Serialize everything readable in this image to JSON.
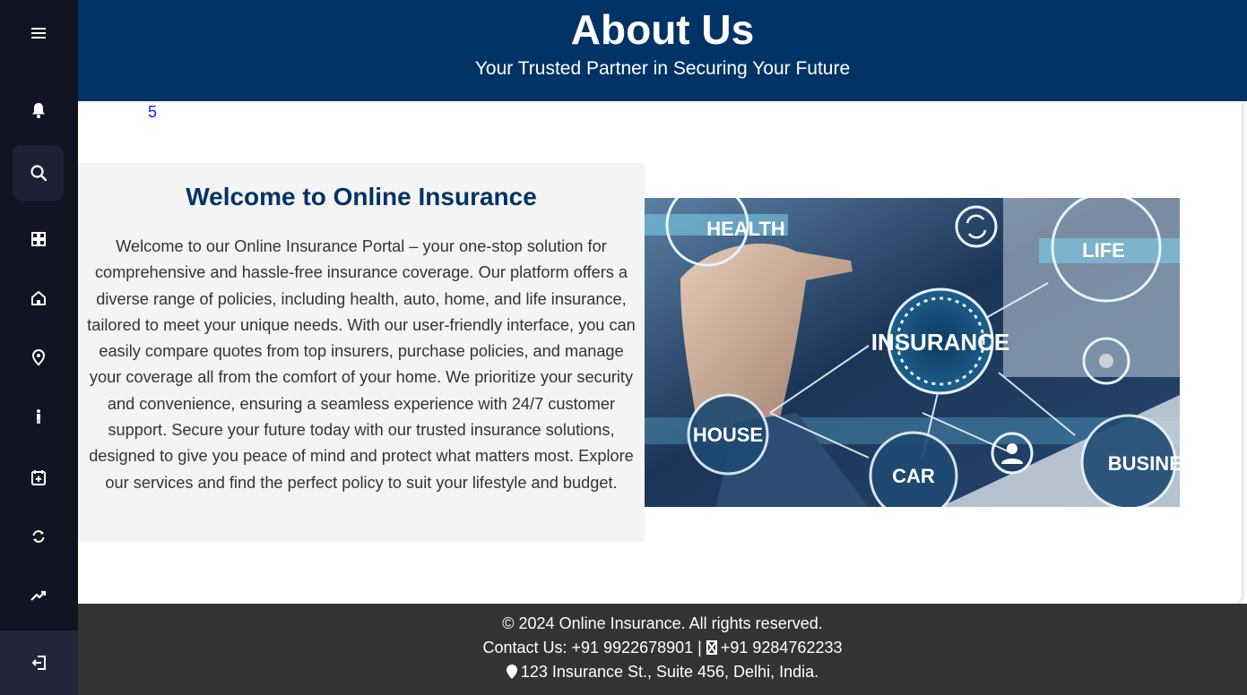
{
  "header": {
    "title": "About Us",
    "subtitle": "Your Trusted Partner in Securing Your Future"
  },
  "main": {
    "stray_number": "5",
    "welcome": {
      "heading": "Welcome to Online Insurance",
      "body": "Welcome to our Online Insurance Portal – your one-stop solution for comprehensive and hassle-free insurance coverage. Our platform offers a diverse range of policies, including health, auto, home, and life insurance, tailored to meet your unique needs. With our user-friendly interface, you can easily compare quotes from top insurers, purchase policies, and manage your coverage all from the comfort of your home. We prioritize your security and convenience, ensuring a seamless experience with 24/7 customer support. Secure your future today with our trusted insurance solutions, designed to give you peace of mind and protect what matters most. Explore our services and find the perfect policy to suit your lifestyle and budget."
    },
    "image_labels": {
      "health": "HEALTH",
      "life": "LIFE",
      "insurance": "INSURANCE",
      "house": "HOUSE",
      "car": "CAR",
      "business": "BUSINESS"
    }
  },
  "sidebar": {
    "items": [
      {
        "icon": "menu-icon"
      },
      {
        "icon": "bell-icon"
      },
      {
        "icon": "search-icon",
        "active": true
      },
      {
        "icon": "dashboard-icon"
      },
      {
        "icon": "home-icon"
      },
      {
        "icon": "location-pin-icon"
      },
      {
        "icon": "person-icon"
      },
      {
        "icon": "calendar-add-icon"
      },
      {
        "icon": "refresh-icon"
      },
      {
        "icon": "trending-up-icon"
      },
      {
        "icon": "logout-icon"
      }
    ]
  },
  "footer": {
    "copyright": "© 2024 Online Insurance. All rights reserved.",
    "contact": "Contact Us: +91 9922678901 | ",
    "phone2": "+91 9284762233",
    "address": "123 Insurance St., Suite 456, Delhi, India."
  },
  "colors": {
    "header_bg": "#003366",
    "sidebar_bg": "#121423",
    "footer_bg": "#333333",
    "heading": "#003366",
    "welcome_bg": "#f4f4f4"
  }
}
